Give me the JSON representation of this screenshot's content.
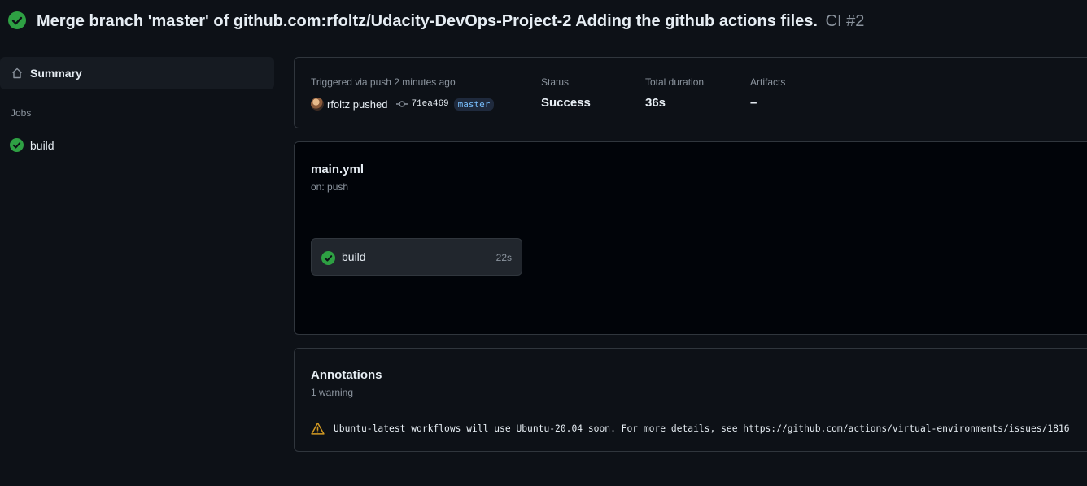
{
  "header": {
    "title": "Merge branch 'master' of github.com:rfoltz/Udacity-DevOps-Project-2 Adding the github actions files.",
    "run": "CI #2",
    "status_icon": "check-circle-icon",
    "success_color": "#2ea043"
  },
  "sidebar": {
    "summary_label": "Summary",
    "summary_icon": "home-icon",
    "jobs_heading": "Jobs",
    "jobs": [
      {
        "label": "build",
        "status_icon": "check-circle-icon"
      }
    ]
  },
  "run_info": {
    "trigger_label": "Triggered via push 2 minutes ago",
    "actor": "rfoltz pushed",
    "commit_sha": "71ea469",
    "branch": "master",
    "status_label": "Status",
    "status_value": "Success",
    "duration_label": "Total duration",
    "duration_value": "36s",
    "artifacts_label": "Artifacts",
    "artifacts_value": "–"
  },
  "workflow": {
    "name": "main.yml",
    "event": "on: push",
    "jobs": [
      {
        "label": "build",
        "duration": "22s",
        "status_icon": "check-circle-icon"
      }
    ]
  },
  "annotations": {
    "title": "Annotations",
    "count": "1 warning",
    "items": [
      {
        "icon": "warning-icon",
        "message": "Ubuntu-latest workflows will use Ubuntu-20.04 soon. For more details, see https://github.com/actions/virtual-environments/issues/1816",
        "color": "#d29922"
      }
    ]
  }
}
